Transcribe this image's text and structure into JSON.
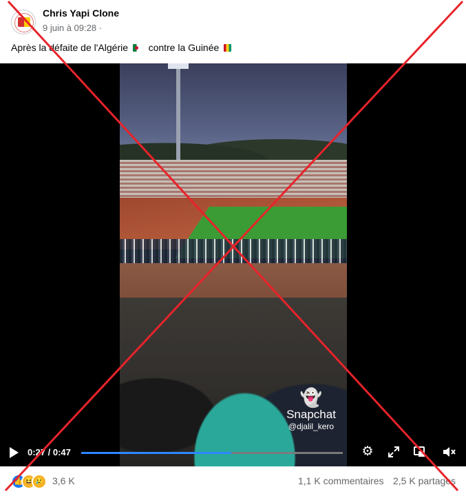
{
  "post": {
    "page_name": "Chris Yapi Clone",
    "date": "9 juin à 09:28 ·",
    "text_part1": "Après la défaite de l'Algérie",
    "text_part2": "contre la Guinée"
  },
  "video": {
    "watermark_app": "Snapchat",
    "watermark_user": "@djalil_kero",
    "time_display": "0:27 / 0:47",
    "progress_fraction": 0.574,
    "icons": [
      "play-icon",
      "settings-icon",
      "expand-icon",
      "picture-in-picture-icon",
      "mute-icon"
    ]
  },
  "footer": {
    "reactions": [
      "like",
      "haha",
      "sad"
    ],
    "reaction_count": "3,6 K",
    "comments": "1,1 K commentaires",
    "shares": "2,5 K partages"
  },
  "colors": {
    "cross": "#e8232a",
    "accent": "#2d88ff",
    "secondary_text": "#65676b"
  }
}
